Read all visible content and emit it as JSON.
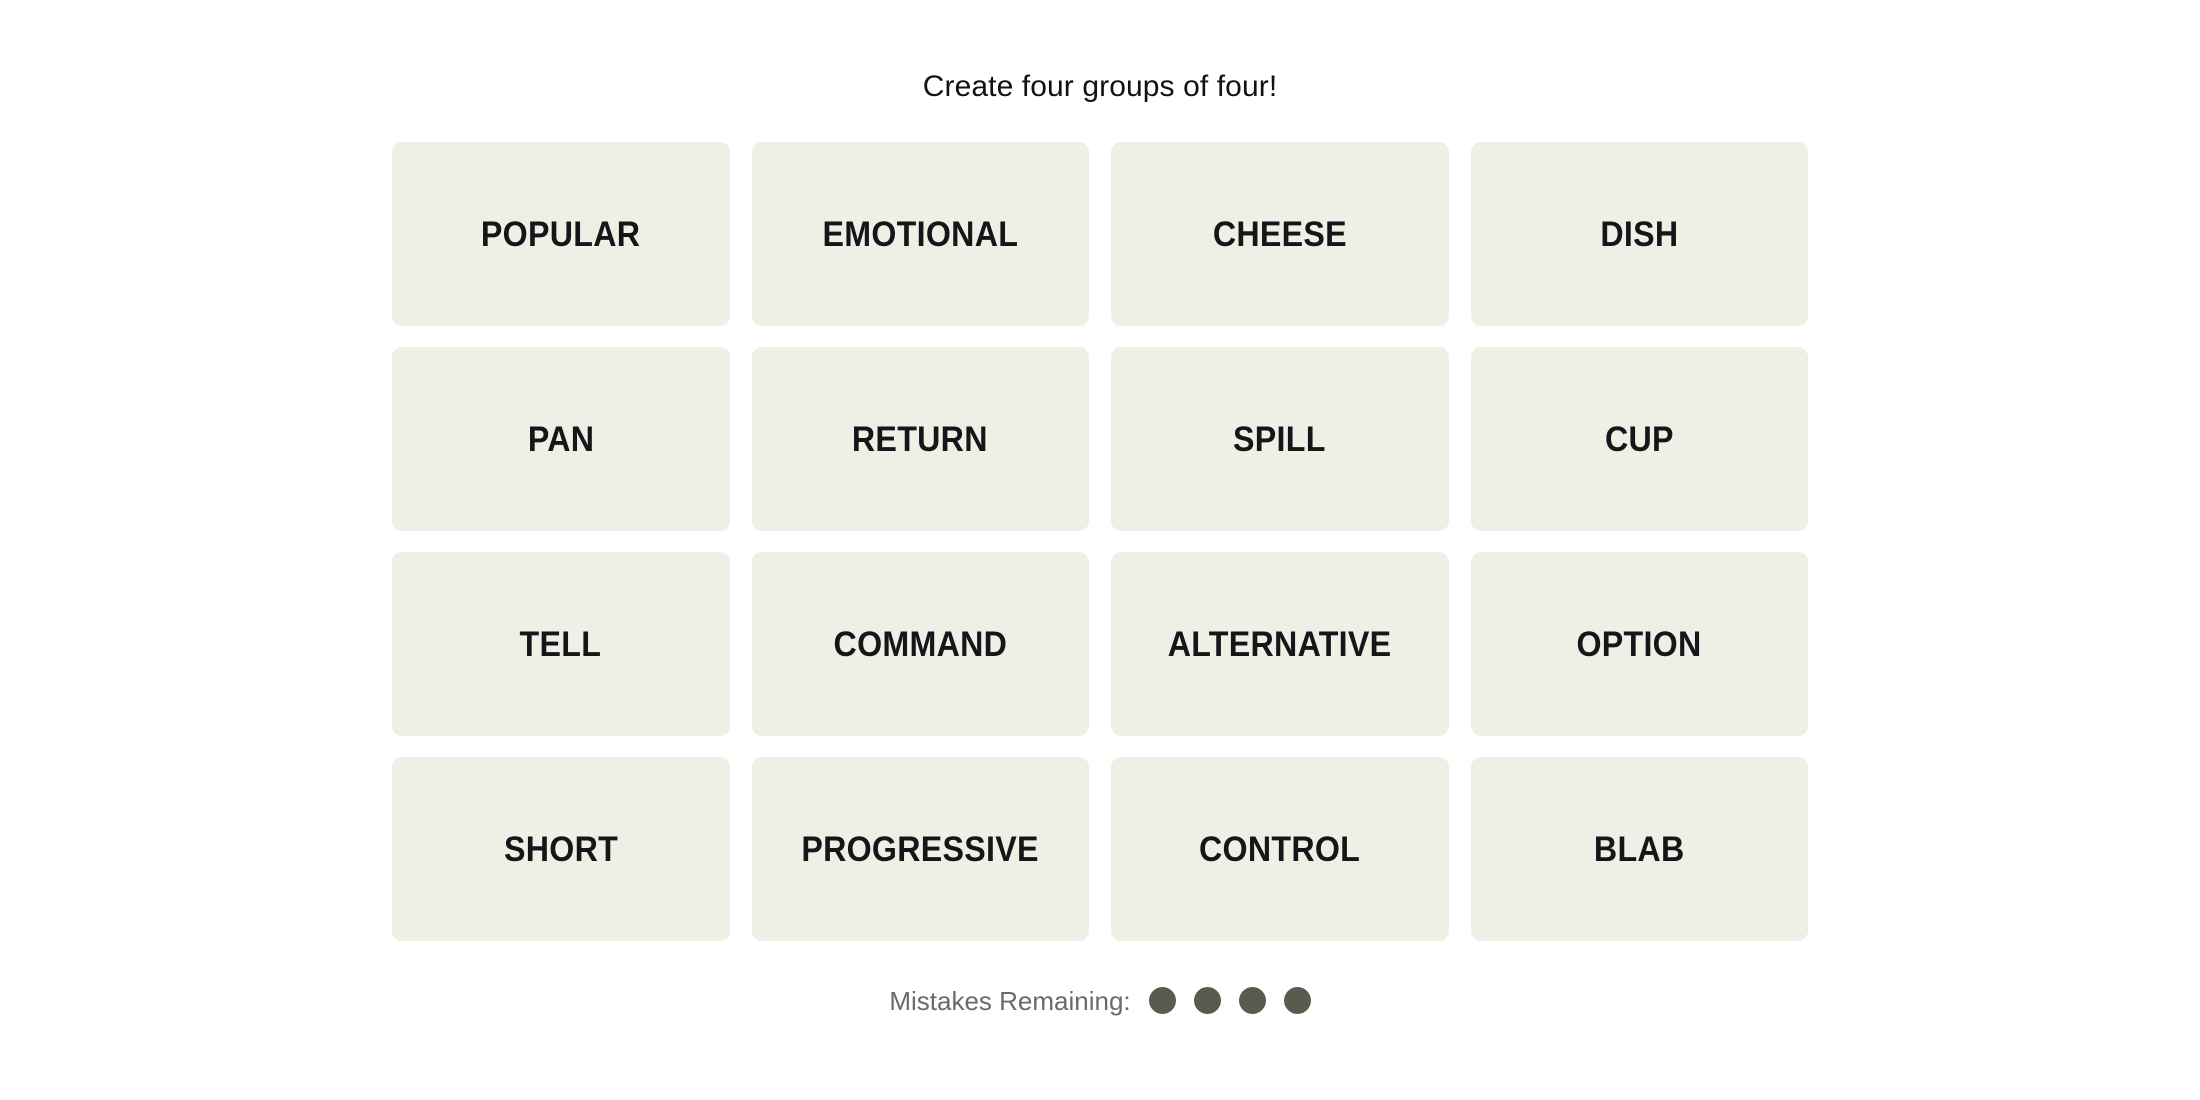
{
  "game": {
    "title": "Create four groups of four!",
    "grid": {
      "rows": [
        [
          {
            "word": "POPULAR"
          },
          {
            "word": "EMOTIONAL"
          },
          {
            "word": "CHEESE"
          },
          {
            "word": "DISH"
          }
        ],
        [
          {
            "word": "PAN"
          },
          {
            "word": "RETURN"
          },
          {
            "word": "SPILL"
          },
          {
            "word": "CUP"
          }
        ],
        [
          {
            "word": "TELL"
          },
          {
            "word": "COMMAND"
          },
          {
            "word": "ALTERNATIVE"
          },
          {
            "word": "OPTION"
          }
        ],
        [
          {
            "word": "SHORT"
          },
          {
            "word": "PROGRESSIVE"
          },
          {
            "word": "CONTROL"
          },
          {
            "word": "BLAB"
          }
        ]
      ]
    },
    "footer": {
      "mistakes_label": "Mistakes Remaining:",
      "mistakes_remaining": 4,
      "dots": [
        "dot-1",
        "dot-2",
        "dot-3",
        "dot-4"
      ]
    },
    "colors": {
      "page_background": "#ffffff",
      "tile_background": "#EFEFE6",
      "tile_text": "#15151a",
      "title_text": "#121212",
      "footer_text": "#6a6a6a",
      "dot_fill": "#5a5a4f"
    }
  }
}
